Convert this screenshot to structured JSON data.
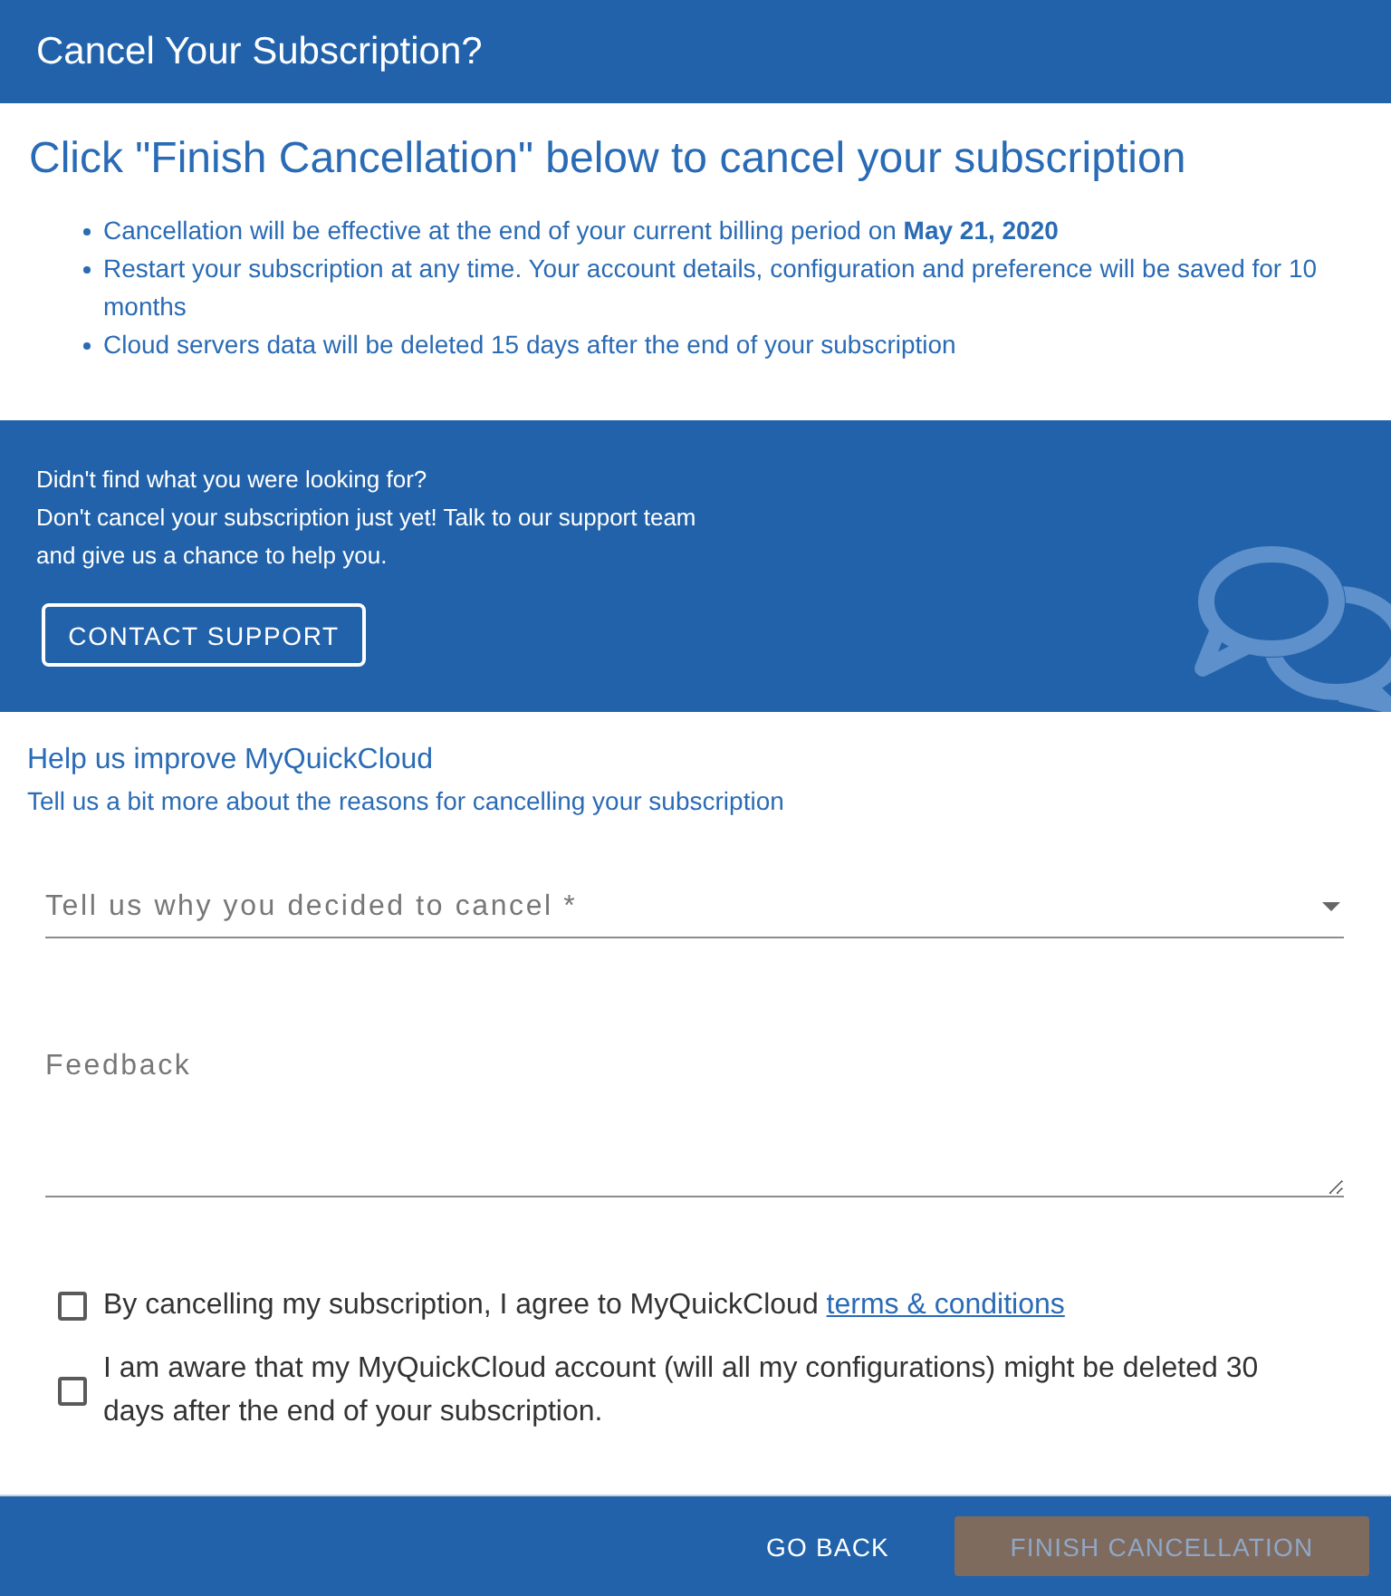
{
  "dialog": {
    "title": "Cancel Your Subscription?"
  },
  "intro": {
    "heading": "Click \"Finish Cancellation\" below to cancel your subscription",
    "bullets": [
      "Cancellation will be effective at the end of your current billing period on **May 21, 2020**",
      "Restart your subscription at any time. Your account details, configuration and preference will be saved for 10 months",
      "Cloud servers data will be deleted 15 days after the end of your subscription"
    ]
  },
  "support_banner": {
    "question": "Didn't find what you were looking for?",
    "message": "Don't cancel your subscription just yet! Talk to our support team and give us a chance to help you.",
    "button": "CONTACT SUPPORT"
  },
  "feedback_form": {
    "title": "Help us improve MyQuickCloud",
    "subtitle": "Tell us a bit more about the reasons for cancelling your subscription",
    "reason_select": {
      "placeholder": "Tell us why you decided to cancel *"
    },
    "feedback_field": {
      "placeholder": "Feedback"
    }
  },
  "agreements": [
    {
      "text": "By cancelling my subscription, I agree to MyQuickCloud",
      "link": "terms & conditions",
      "checked": false
    },
    {
      "text": "I am aware that my MyQuickCloud account (will all my configurations) might be deleted 30 days after the end of your subscription.",
      "checked": false
    }
  ],
  "footer": {
    "buttons": [
      {
        "label": "GO BACK",
        "kind": "text",
        "disabled": false
      },
      {
        "label": "FINISH CANCELLATION",
        "kind": "contained",
        "disabled": true
      }
    ]
  }
}
